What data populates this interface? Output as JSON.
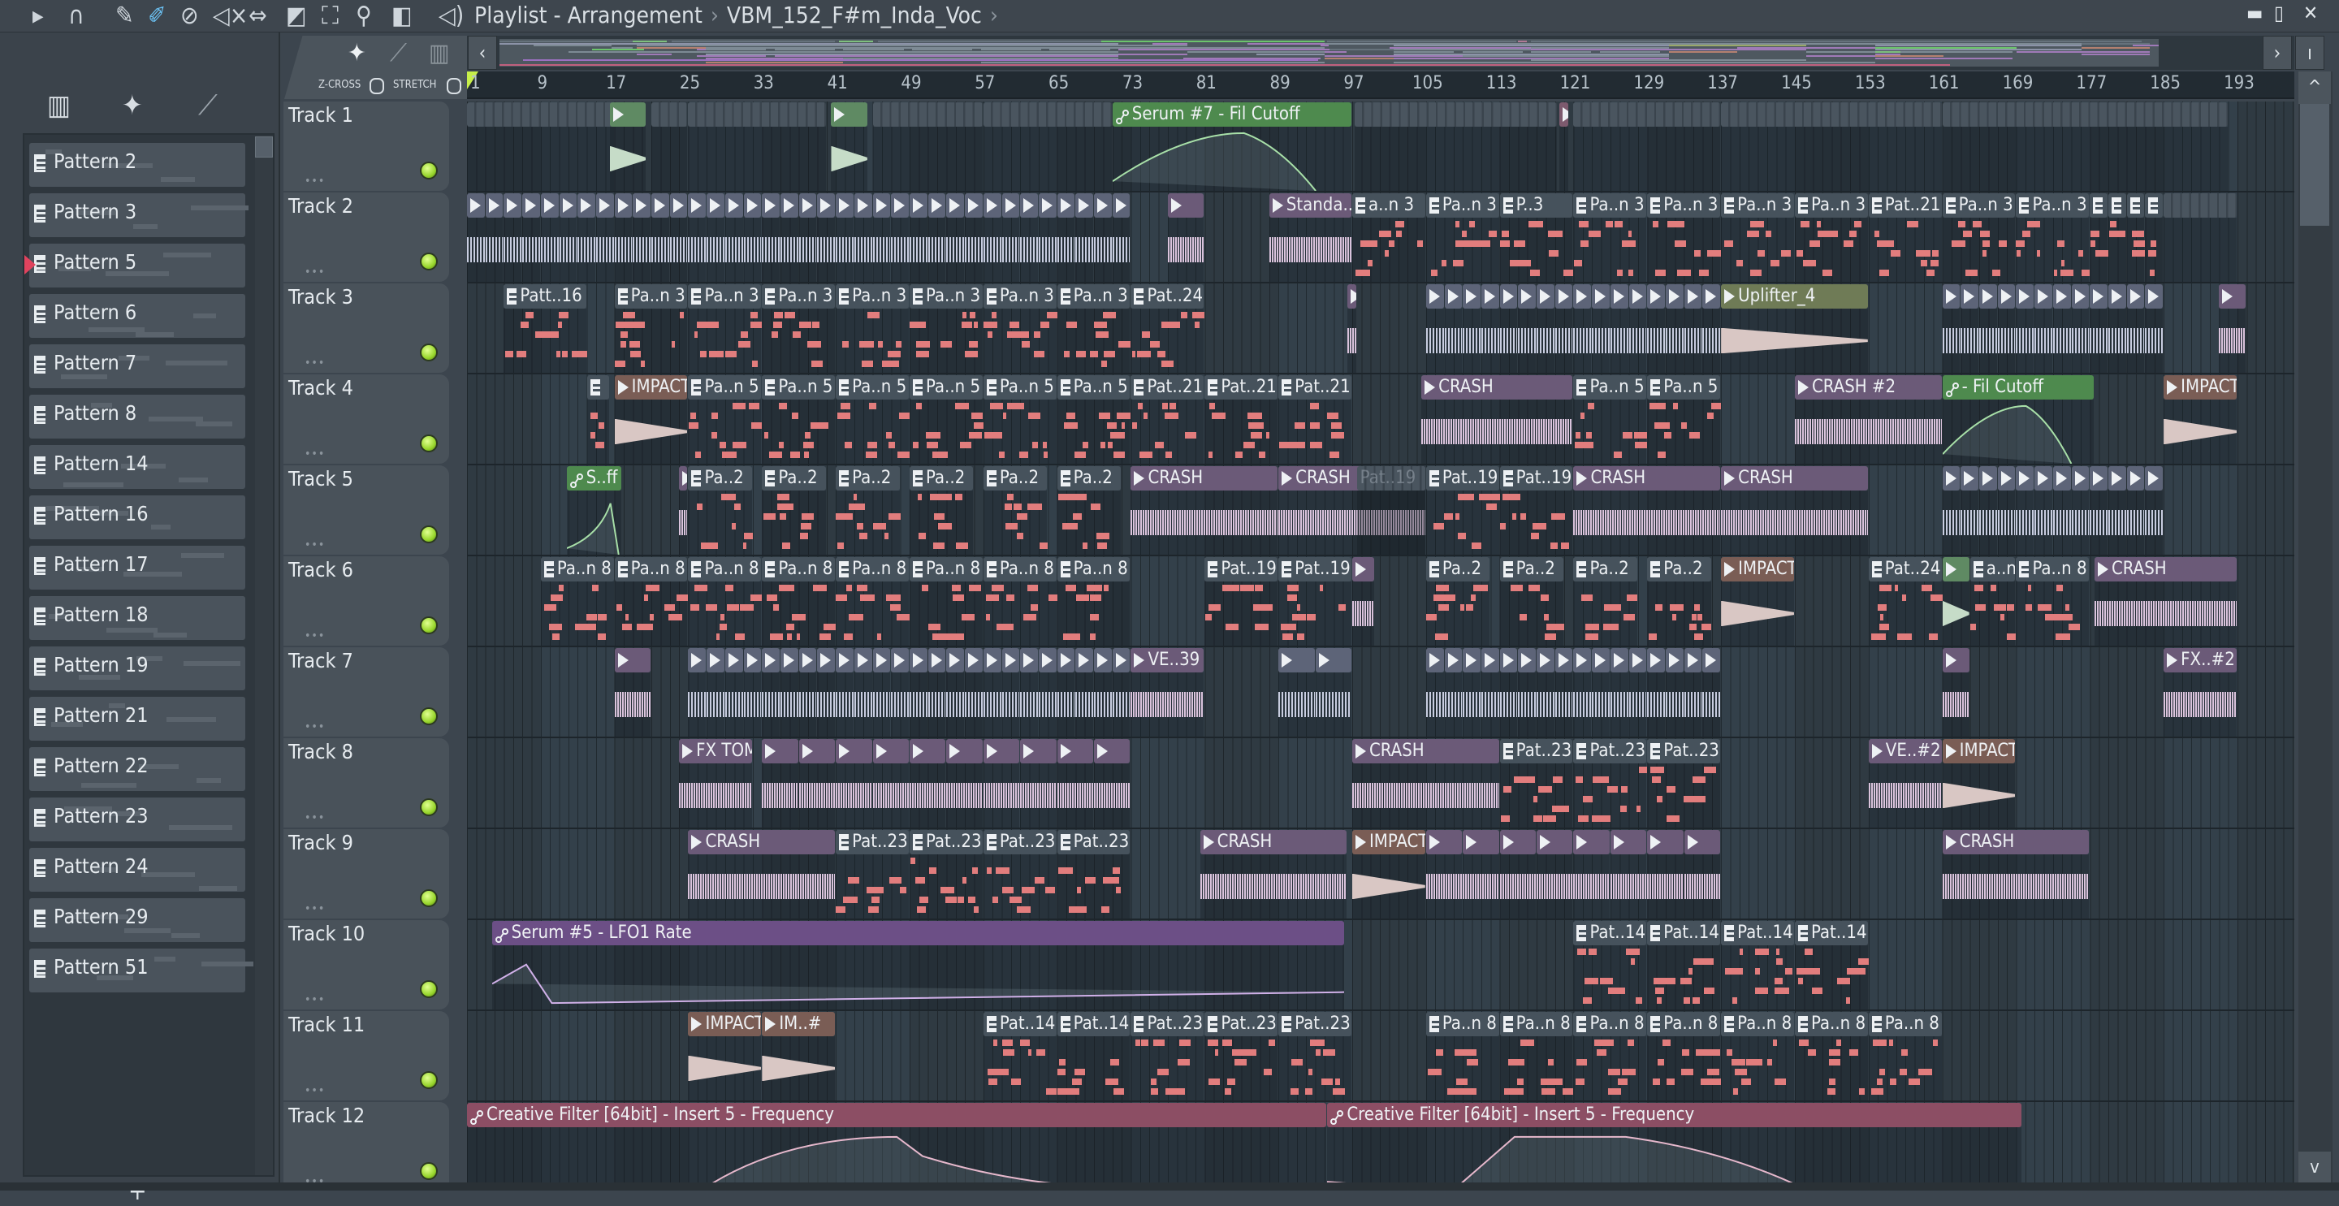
{
  "window": {
    "breadcrumb": [
      "Playlist - Arrangement",
      "VBM_152_F#m_Inda_Voc"
    ],
    "controls": [
      "minimize",
      "maximize",
      "close"
    ]
  },
  "toolbar": {
    "icons": [
      "play-arrow-icon",
      "magnet-snap-icon",
      "pencil-icon",
      "paint-brush-icon",
      "delete-icon",
      "mute-icon",
      "slip-icon",
      "slice-icon",
      "select-icon",
      "zoom-icon",
      "playback-icon",
      "speaker-icon"
    ]
  },
  "mode_panel": {
    "zcross_label": "Z-CROSS",
    "stretch_label": "STRETCH"
  },
  "picker": {
    "items": [
      "Pattern 2",
      "Pattern 3",
      "Pattern 5",
      "Pattern 6",
      "Pattern 7",
      "Pattern 8",
      "Pattern 14",
      "Pattern 16",
      "Pattern 17",
      "Pattern 18",
      "Pattern 19",
      "Pattern 21",
      "Pattern 22",
      "Pattern 23",
      "Pattern 24",
      "Pattern 29",
      "Pattern 51"
    ],
    "selected": "Pattern 5",
    "add_label": "+"
  },
  "ruler": {
    "bars": [
      1,
      9,
      17,
      25,
      33,
      41,
      49,
      57,
      65,
      73,
      81,
      89,
      97,
      105,
      113,
      121,
      129,
      137,
      145,
      153,
      161,
      169,
      177,
      185,
      193
    ],
    "playhead_bar": 1
  },
  "colors": {
    "accent_led": "#98d62c",
    "note": "#e27d7d",
    "playhead": "#c7ef4a",
    "selection": "#e0435e"
  },
  "tracks": [
    {
      "name": "Track 1",
      "clips": [
        {
          "start": 1,
          "len": 16,
          "kind": "ghost",
          "label": ""
        },
        {
          "start": 16.5,
          "len": 4,
          "kind": "audiogreen",
          "label": ""
        },
        {
          "start": 21,
          "len": 4,
          "kind": "ghost",
          "label": ""
        },
        {
          "start": 25,
          "len": 15,
          "kind": "ghost",
          "label": ""
        },
        {
          "start": 40.5,
          "len": 4,
          "kind": "audiogreen",
          "label": ""
        },
        {
          "start": 45,
          "len": 12,
          "kind": "ghost",
          "label": ""
        },
        {
          "start": 57,
          "len": 14,
          "kind": "ghost",
          "label": ""
        },
        {
          "start": 71,
          "len": 26,
          "kind": "autogreen",
          "label": "Serum #7 - Fil Cutoff",
          "curve": "arc"
        },
        {
          "start": 97.3,
          "len": 22,
          "kind": "ghost",
          "label": ""
        },
        {
          "start": 119.5,
          "len": 1,
          "kind": "ghostpink",
          "label": ""
        },
        {
          "start": 121,
          "len": 16,
          "kind": "ghost",
          "label": ""
        },
        {
          "start": 137,
          "len": 24,
          "kind": "ghost",
          "label": ""
        },
        {
          "start": 161,
          "len": 31,
          "kind": "ghost",
          "label": ""
        }
      ]
    },
    {
      "name": "Track 2",
      "clips": [
        {
          "start": 1,
          "len": 2,
          "repeat": 36,
          "kind": "audiogrey",
          "label": ""
        },
        {
          "start": 77,
          "len": 4,
          "kind": "audiopurple",
          "label": ""
        },
        {
          "start": 88,
          "len": 9,
          "kind": "audiopurple",
          "label": "Standa..[F]"
        },
        {
          "start": 97,
          "len": 8,
          "kind": "pattern",
          "label": "a..n 3"
        },
        {
          "start": 105,
          "len": 8,
          "kind": "pattern",
          "label": "Pa..n 3"
        },
        {
          "start": 113,
          "len": 8,
          "kind": "pattern",
          "label": "P..3"
        },
        {
          "start": 121,
          "len": 8,
          "repeat": 4,
          "kind": "pattern",
          "label": "Pa..n 3"
        },
        {
          "start": 153,
          "len": 8,
          "kind": "pattern",
          "label": "Pat..21"
        },
        {
          "start": 161,
          "len": 8,
          "repeat": 2,
          "kind": "pattern",
          "label": "Pa..n 3"
        },
        {
          "start": 177,
          "len": 2,
          "repeat": 4,
          "kind": "pattern",
          "label": ""
        },
        {
          "start": 185,
          "len": 8,
          "kind": "ghost",
          "label": ""
        }
      ]
    },
    {
      "name": "Track 3",
      "clips": [
        {
          "start": 5,
          "len": 9,
          "kind": "pattern",
          "label": "Patt..16"
        },
        {
          "start": 17,
          "len": 8,
          "repeat": 7,
          "kind": "pattern",
          "label": "Pa..n 3"
        },
        {
          "start": 73,
          "len": 8,
          "kind": "pattern",
          "label": "Pat..24"
        },
        {
          "start": 96.5,
          "len": 1,
          "kind": "audiopurple",
          "label": ""
        },
        {
          "start": 105,
          "len": 2,
          "repeat": 16,
          "kind": "audiogrey",
          "label": ""
        },
        {
          "start": 137,
          "len": 16,
          "kind": "audioolive",
          "label": "Uplifter_4"
        },
        {
          "start": 161,
          "len": 2,
          "repeat": 12,
          "kind": "audiogrey",
          "label": ""
        },
        {
          "start": 191,
          "len": 3,
          "kind": "audiopurple",
          "label": ""
        }
      ]
    },
    {
      "name": "Track 4",
      "clips": [
        {
          "start": 14,
          "len": 2.5,
          "kind": "pattern",
          "label": ""
        },
        {
          "start": 17,
          "len": 8,
          "kind": "audiobrown",
          "label": "IMPACT"
        },
        {
          "start": 25,
          "len": 8,
          "repeat": 6,
          "kind": "pattern",
          "label": "Pa..n 5"
        },
        {
          "start": 73,
          "len": 8,
          "repeat": 3,
          "kind": "pattern",
          "label": "Pat..21"
        },
        {
          "start": 104.5,
          "len": 16.5,
          "kind": "audiopurple",
          "label": "CRASH"
        },
        {
          "start": 121,
          "len": 8,
          "repeat": 2,
          "kind": "pattern",
          "label": "Pa..n 5"
        },
        {
          "start": 145,
          "len": 16,
          "kind": "audiopurple",
          "label": "CRASH #2"
        },
        {
          "start": 161,
          "len": 16.5,
          "kind": "autogreen",
          "label": "- Fil Cutoff",
          "curve": "arc"
        },
        {
          "start": 185,
          "len": 8,
          "kind": "audiobrown",
          "label": "IMPACT"
        }
      ]
    },
    {
      "name": "Track 5",
      "clips": [
        {
          "start": 11.8,
          "len": 6,
          "kind": "autogreen",
          "label": "S..ff",
          "curve": "rise"
        },
        {
          "start": 24,
          "len": 1,
          "kind": "audiopurple",
          "label": ""
        },
        {
          "start": 25,
          "len": 7,
          "kind": "pattern",
          "label": "Pa..2"
        },
        {
          "start": 33,
          "len": 7,
          "kind": "pattern",
          "label": "Pa..2"
        },
        {
          "start": 41,
          "len": 7,
          "kind": "pattern",
          "label": "Pa..2"
        },
        {
          "start": 49,
          "len": 7,
          "kind": "pattern",
          "label": "Pa..2"
        },
        {
          "start": 57,
          "len": 7,
          "kind": "pattern",
          "label": "Pa..2"
        },
        {
          "start": 65,
          "len": 7,
          "kind": "pattern",
          "label": "Pa..2"
        },
        {
          "start": 73,
          "len": 16,
          "repeat": 2,
          "kind": "audiopurple",
          "label": "CRASH"
        },
        {
          "start": 97.5,
          "len": 7.5,
          "kind": "ghost",
          "label": "Pat..19"
        },
        {
          "start": 105,
          "len": 8,
          "repeat": 2,
          "kind": "pattern",
          "label": "Pat..19"
        },
        {
          "start": 121,
          "len": 16,
          "repeat": 2,
          "kind": "audiopurple",
          "label": "CRASH"
        },
        {
          "start": 161,
          "len": 2,
          "repeat": 12,
          "kind": "audiogrey",
          "label": ""
        }
      ]
    },
    {
      "name": "Track 6",
      "clips": [
        {
          "start": 9,
          "len": 8,
          "repeat": 8,
          "kind": "pattern",
          "label": "Pa..n 8"
        },
        {
          "start": 81,
          "len": 8,
          "repeat": 2,
          "kind": "pattern",
          "label": "Pat..19"
        },
        {
          "start": 97,
          "len": 2.5,
          "kind": "audiopurple",
          "label": ""
        },
        {
          "start": 105,
          "len": 7,
          "kind": "pattern",
          "label": "Pa..2"
        },
        {
          "start": 113,
          "len": 7,
          "kind": "pattern",
          "label": "Pa..2"
        },
        {
          "start": 121,
          "len": 7,
          "kind": "pattern",
          "label": "Pa..2"
        },
        {
          "start": 129,
          "len": 7,
          "kind": "pattern",
          "label": "Pa..2"
        },
        {
          "start": 137,
          "len": 8,
          "kind": "audiobrown",
          "label": "IMPACT"
        },
        {
          "start": 153,
          "len": 8,
          "kind": "pattern",
          "label": "Pat..24"
        },
        {
          "start": 161,
          "len": 3,
          "kind": "audiogreen",
          "label": ""
        },
        {
          "start": 164,
          "len": 5,
          "kind": "pattern",
          "label": "a..n 8"
        },
        {
          "start": 169,
          "len": 8,
          "kind": "pattern",
          "label": "Pa..n 8"
        },
        {
          "start": 177.5,
          "len": 15.5,
          "kind": "audiopurple",
          "label": "CRASH"
        }
      ]
    },
    {
      "name": "Track 7",
      "clips": [
        {
          "start": 17,
          "len": 4,
          "kind": "audiopurple",
          "label": ""
        },
        {
          "start": 25,
          "len": 2,
          "repeat": 24,
          "kind": "audiogrey",
          "label": ""
        },
        {
          "start": 73,
          "len": 8,
          "kind": "audiopurple",
          "label": "VE..39"
        },
        {
          "start": 89,
          "len": 4,
          "repeat": 2,
          "kind": "audiogrey",
          "label": ""
        },
        {
          "start": 105,
          "len": 2,
          "repeat": 16,
          "kind": "audiogrey",
          "label": ""
        },
        {
          "start": 161,
          "len": 3,
          "kind": "audiopurple",
          "label": ""
        },
        {
          "start": 185,
          "len": 8,
          "kind": "audiopurple",
          "label": "FX..#2"
        }
      ]
    },
    {
      "name": "Track 8",
      "clips": [
        {
          "start": 24,
          "len": 8,
          "kind": "audiopurple",
          "label": "FX TOM"
        },
        {
          "start": 33,
          "len": 4,
          "repeat": 10,
          "kind": "audiopurple",
          "label": ""
        },
        {
          "start": 97,
          "len": 16,
          "kind": "audiopurple",
          "label": "CRASH"
        },
        {
          "start": 113,
          "len": 8,
          "repeat": 3,
          "kind": "pattern",
          "label": "Pat..23"
        },
        {
          "start": 153,
          "len": 8,
          "kind": "audiopurple",
          "label": "VE..#2"
        },
        {
          "start": 161,
          "len": 8,
          "kind": "audiobrown",
          "label": "IMPACT"
        }
      ]
    },
    {
      "name": "Track 9",
      "clips": [
        {
          "start": 25,
          "len": 16,
          "kind": "audiopurple",
          "label": "CRASH"
        },
        {
          "start": 41,
          "len": 8,
          "repeat": 4,
          "kind": "pattern",
          "label": "Pat..23"
        },
        {
          "start": 80.5,
          "len": 16,
          "kind": "audiopurple",
          "label": "CRASH"
        },
        {
          "start": 97,
          "len": 8,
          "kind": "audiobrown",
          "label": "IMPACT"
        },
        {
          "start": 105,
          "len": 4,
          "repeat": 8,
          "kind": "audiopurple",
          "label": ""
        },
        {
          "start": 161,
          "len": 16,
          "kind": "audiopurple",
          "label": "CRASH"
        }
      ]
    },
    {
      "name": "Track 10",
      "clips": [
        {
          "start": 3.7,
          "len": 92.5,
          "kind": "autopurple",
          "label": "Serum #5 - LFO1 Rate",
          "curve": "lfo"
        },
        {
          "start": 121,
          "len": 8,
          "repeat": 4,
          "kind": "pattern",
          "label": "Pat..14"
        }
      ]
    },
    {
      "name": "Track 11",
      "clips": [
        {
          "start": 25,
          "len": 8,
          "kind": "audiobrown",
          "label": "IMPACT"
        },
        {
          "start": 33,
          "len": 8,
          "kind": "audiobrown",
          "label": "IM..#"
        },
        {
          "start": 57,
          "len": 8,
          "repeat": 2,
          "kind": "pattern",
          "label": "Pat..14"
        },
        {
          "start": 73,
          "len": 8,
          "repeat": 3,
          "kind": "pattern",
          "label": "Pat..23"
        },
        {
          "start": 105,
          "len": 8,
          "repeat": 7,
          "kind": "pattern",
          "label": "Pa..n 8"
        }
      ]
    },
    {
      "name": "Track 12",
      "clips": [
        {
          "start": 1,
          "len": 93.3,
          "kind": "autopink",
          "label": "Creative Filter [64bit] - Insert 5 - Frequency",
          "curve": "filter"
        },
        {
          "start": 94.3,
          "len": 75.4,
          "kind": "autopink",
          "label": "Creative Filter [64bit] - Insert 5 - Frequency",
          "curve": "filter2"
        }
      ]
    }
  ]
}
